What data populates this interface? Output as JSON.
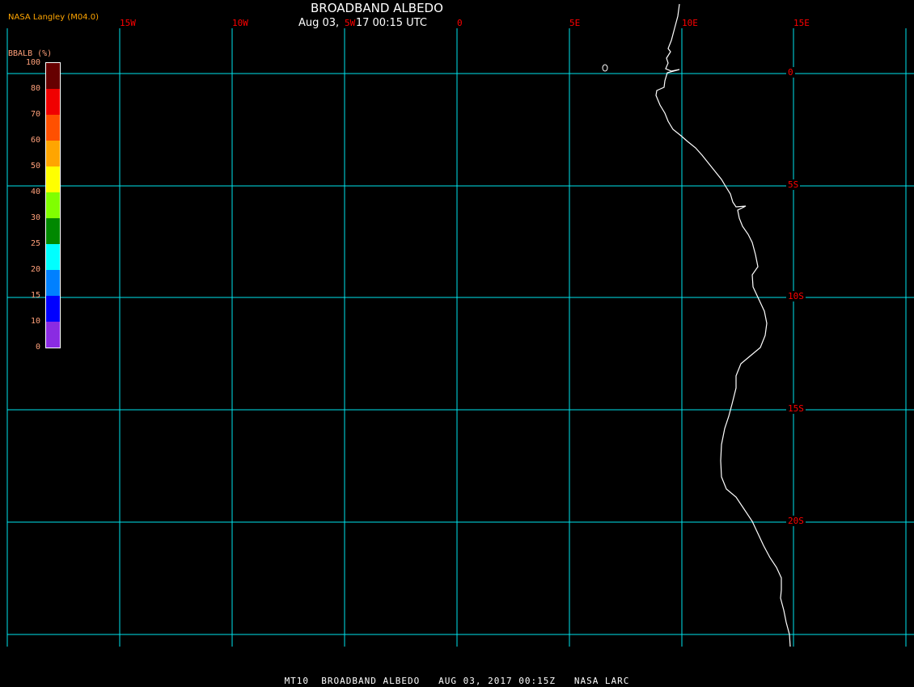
{
  "header": {
    "title": "BROADBAND ALBEDO",
    "datetime": "Aug 03, 2017 00:15 UTC",
    "credit": "NASA Langley (M04.0)"
  },
  "legend": {
    "title": "BBALB (%)",
    "ticks": [
      "100",
      "80",
      "70",
      "60",
      "50",
      "40",
      "30",
      "25",
      "20",
      "15",
      "10",
      "0"
    ],
    "colors": [
      "#660000",
      "#f00000",
      "#ff5000",
      "#ffa500",
      "#ffff00",
      "#80ff00",
      "#008800",
      "#00ffff",
      "#0080ff",
      "#0000ff",
      "#8a2be2"
    ]
  },
  "map": {
    "longitude_labels": [
      "15W",
      "10W",
      "5W",
      "0",
      "5E",
      "10E",
      "15E"
    ],
    "latitude_labels": [
      "0",
      "5S",
      "10S",
      "15S",
      "20S"
    ],
    "grid_color": "#00e5ee",
    "label_color": "#ff0000",
    "coastline_color": "#ffffff"
  },
  "footer": {
    "text": "MT10  BROADBAND ALBEDO   AUG 03, 2017 00:15Z   NASA LARC"
  }
}
